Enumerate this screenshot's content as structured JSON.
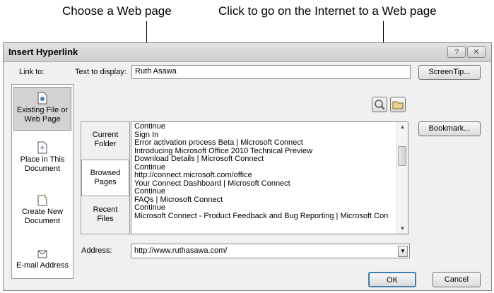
{
  "callouts": {
    "choose": "Choose a Web page",
    "internet": "Click to go on the Internet to a Web page"
  },
  "dialog": {
    "title": "Insert Hyperlink",
    "help_glyph": "?",
    "close_glyph": "✕",
    "link_to_label": "Link to:",
    "text_to_display_label": "Text to display:",
    "text_to_display_value": "Ruth Asawa",
    "screentip_label": "ScreenTip...",
    "bookmark_label": "Bookmark...",
    "address_label": "Address:",
    "address_value": "http://www.ruthasawa.com/",
    "ok_label": "OK",
    "cancel_label": "Cancel",
    "link_to_items": [
      {
        "label1": "Existing File or",
        "label2": "Web Page",
        "icon": "existing-file-icon"
      },
      {
        "label1": "Place in This",
        "label2": "Document",
        "icon": "place-in-document-icon"
      },
      {
        "label1": "Create New",
        "label2": "Document",
        "icon": "create-new-document-icon"
      },
      {
        "label1": "E-mail Address",
        "label2": "",
        "icon": "email-address-icon"
      }
    ],
    "look_in_items": [
      {
        "label1": "Current",
        "label2": "Folder"
      },
      {
        "label1": "Browsed",
        "label2": "Pages"
      },
      {
        "label1": "Recent",
        "label2": "Files"
      }
    ],
    "browse_items": [
      "Continue",
      "Sign In",
      "Error activation process Beta | Microsoft Connect",
      "Introducing Microsoft Office 2010 Technical Preview",
      "Download Details | Microsoft Connect",
      "Continue",
      "http://connect.microsoft.com/office",
      "Your Connect Dashboard | Microsoft Connect",
      "Continue",
      "FAQs | Microsoft Connect",
      "Continue",
      "Microsoft Connect - Product Feedback and Bug Reporting | Microsoft Con"
    ]
  }
}
